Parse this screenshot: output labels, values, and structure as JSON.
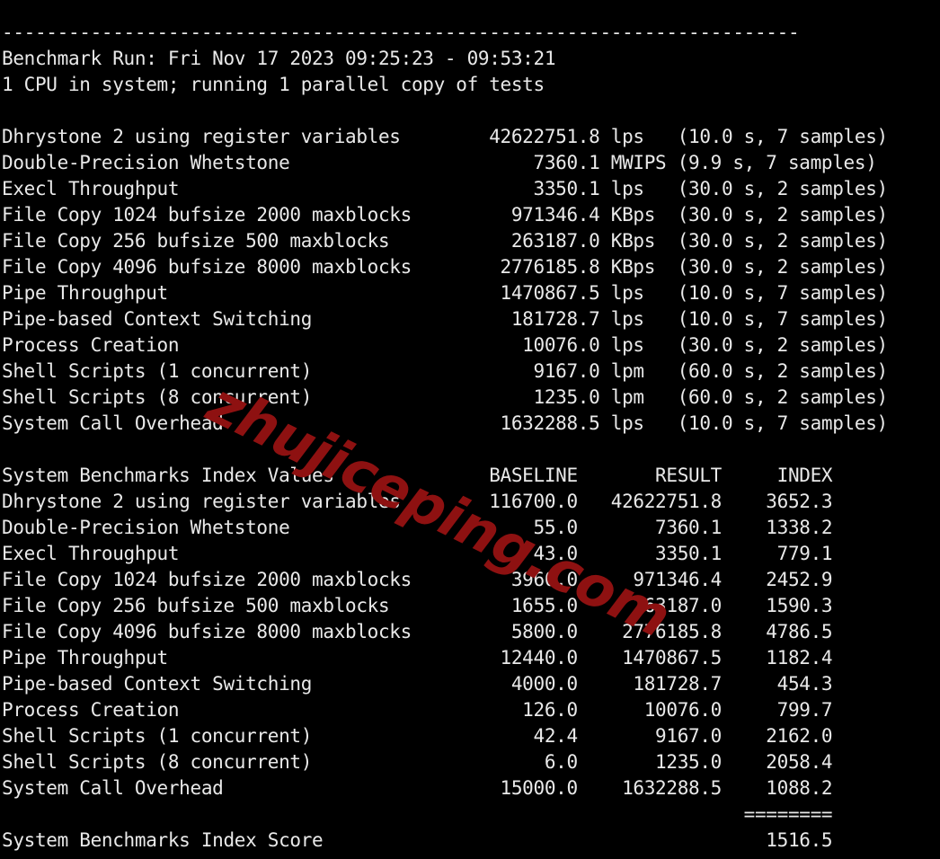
{
  "terminal": {
    "background_color": "#000000",
    "text_color": "#e9e9e9",
    "separator_top": "------------------------------------------------------------------------",
    "header": {
      "run_line": "Benchmark Run: Fri Nov 17 2023 09:25:23 - 09:53:21",
      "cpu_line": "1 CPU in system; running 1 parallel copy of tests"
    },
    "results_table": {
      "rows": [
        {
          "name": "Dhrystone 2 using register variables",
          "value": "42622751.8",
          "unit": "lps",
          "detail": "(10.0 s, 7 samples)"
        },
        {
          "name": "Double-Precision Whetstone",
          "value": "7360.1",
          "unit": "MWIPS",
          "detail": "(9.9 s, 7 samples)"
        },
        {
          "name": "Execl Throughput",
          "value": "3350.1",
          "unit": "lps",
          "detail": "(30.0 s, 2 samples)"
        },
        {
          "name": "File Copy 1024 bufsize 2000 maxblocks",
          "value": "971346.4",
          "unit": "KBps",
          "detail": "(30.0 s, 2 samples)"
        },
        {
          "name": "File Copy 256 bufsize 500 maxblocks",
          "value": "263187.0",
          "unit": "KBps",
          "detail": "(30.0 s, 2 samples)"
        },
        {
          "name": "File Copy 4096 bufsize 8000 maxblocks",
          "value": "2776185.8",
          "unit": "KBps",
          "detail": "(30.0 s, 2 samples)"
        },
        {
          "name": "Pipe Throughput",
          "value": "1470867.5",
          "unit": "lps",
          "detail": "(10.0 s, 7 samples)"
        },
        {
          "name": "Pipe-based Context Switching",
          "value": "181728.7",
          "unit": "lps",
          "detail": "(10.0 s, 7 samples)"
        },
        {
          "name": "Process Creation",
          "value": "10076.0",
          "unit": "lps",
          "detail": "(30.0 s, 2 samples)"
        },
        {
          "name": "Shell Scripts (1 concurrent)",
          "value": "9167.0",
          "unit": "lpm",
          "detail": "(60.0 s, 2 samples)"
        },
        {
          "name": "Shell Scripts (8 concurrent)",
          "value": "1235.0",
          "unit": "lpm",
          "detail": "(60.0 s, 2 samples)"
        },
        {
          "name": "System Call Overhead",
          "value": "1632288.5",
          "unit": "lps",
          "detail": "(10.0 s, 7 samples)"
        }
      ]
    },
    "index_table": {
      "title": "System Benchmarks Index Values",
      "columns": [
        "BASELINE",
        "RESULT",
        "INDEX"
      ],
      "rows": [
        {
          "name": "Dhrystone 2 using register variables",
          "baseline": "116700.0",
          "result": "42622751.8",
          "index": "3652.3"
        },
        {
          "name": "Double-Precision Whetstone",
          "baseline": "55.0",
          "result": "7360.1",
          "index": "1338.2"
        },
        {
          "name": "Execl Throughput",
          "baseline": "43.0",
          "result": "3350.1",
          "index": "779.1"
        },
        {
          "name": "File Copy 1024 bufsize 2000 maxblocks",
          "baseline": "3960.0",
          "result": "971346.4",
          "index": "2452.9"
        },
        {
          "name": "File Copy 256 bufsize 500 maxblocks",
          "baseline": "1655.0",
          "result": "263187.0",
          "index": "1590.3"
        },
        {
          "name": "File Copy 4096 bufsize 8000 maxblocks",
          "baseline": "5800.0",
          "result": "2776185.8",
          "index": "4786.5"
        },
        {
          "name": "Pipe Throughput",
          "baseline": "12440.0",
          "result": "1470867.5",
          "index": "1182.4"
        },
        {
          "name": "Pipe-based Context Switching",
          "baseline": "4000.0",
          "result": "181728.7",
          "index": "454.3"
        },
        {
          "name": "Process Creation",
          "baseline": "126.0",
          "result": "10076.0",
          "index": "799.7"
        },
        {
          "name": "Shell Scripts (1 concurrent)",
          "baseline": "42.4",
          "result": "9167.0",
          "index": "2162.0"
        },
        {
          "name": "Shell Scripts (8 concurrent)",
          "baseline": "6.0",
          "result": "1235.0",
          "index": "2058.4"
        },
        {
          "name": "System Call Overhead",
          "baseline": "15000.0",
          "result": "1632288.5",
          "index": "1088.2"
        }
      ]
    },
    "score_separator": "========",
    "score": {
      "label": "System Benchmarks Index Score",
      "value": "1516.5"
    }
  },
  "watermark": {
    "text": "zhujiceping.com",
    "color": "#8e1111"
  }
}
